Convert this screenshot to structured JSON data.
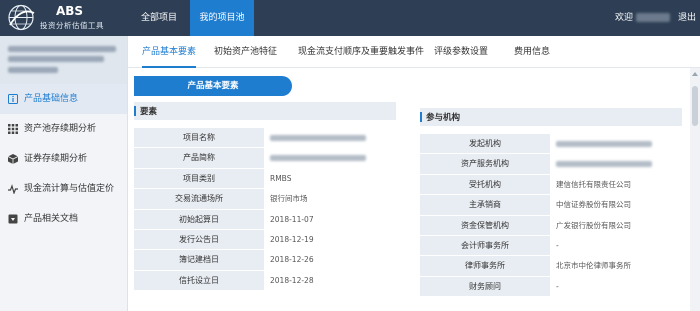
{
  "app": {
    "title": "ABS",
    "subtitle": "投资分析估值工具"
  },
  "nav": {
    "all_projects": "全部项目",
    "my_pool": "我的项目池"
  },
  "header": {
    "welcome": "欢迎",
    "logout": "退出"
  },
  "sidebar": {
    "items": [
      {
        "label": "产品基础信息",
        "icon": "info-icon"
      },
      {
        "label": "资产池存续期分析",
        "icon": "grid-icon"
      },
      {
        "label": "证券存续期分析",
        "icon": "cube-icon"
      },
      {
        "label": "现金流计算与估值定价",
        "icon": "pulse-icon"
      },
      {
        "label": "产品相关文档",
        "icon": "document-icon"
      }
    ]
  },
  "tabs": [
    {
      "label": "产品基本要素"
    },
    {
      "label": "初始资产池特征"
    },
    {
      "label": "现金流支付顺序及重要触发事件"
    },
    {
      "label": "评级参数设置"
    },
    {
      "label": "费用信息"
    }
  ],
  "panel": {
    "title": "产品基本要素"
  },
  "elements": {
    "title": "要素",
    "rows": [
      {
        "label": "项目名称",
        "value": ""
      },
      {
        "label": "产品简称",
        "value": ""
      },
      {
        "label": "项目类别",
        "value": "RMBS"
      },
      {
        "label": "交易流通场所",
        "value": "银行间市场"
      },
      {
        "label": "初始起算日",
        "value": "2018-11-07"
      },
      {
        "label": "发行公告日",
        "value": "2018-12-19"
      },
      {
        "label": "簿记建档日",
        "value": "2018-12-26"
      },
      {
        "label": "信托设立日",
        "value": "2018-12-28"
      }
    ]
  },
  "institutions": {
    "title": "参与机构",
    "rows": [
      {
        "label": "发起机构",
        "value": ""
      },
      {
        "label": "资产服务机构",
        "value": ""
      },
      {
        "label": "受托机构",
        "value": "建信信托有限责任公司"
      },
      {
        "label": "主承销商",
        "value": "中信证券股份有限公司"
      },
      {
        "label": "资金保管机构",
        "value": "广发银行股份有限公司"
      },
      {
        "label": "会计师事务所",
        "value": "-"
      },
      {
        "label": "律师事务所",
        "value": "北京市中伦律师事务所"
      },
      {
        "label": "财务顾问",
        "value": "-"
      }
    ]
  },
  "colors": {
    "topbar": "#2e3f55",
    "accent": "#1f7dd0",
    "label_bg": "#e8edf3"
  }
}
